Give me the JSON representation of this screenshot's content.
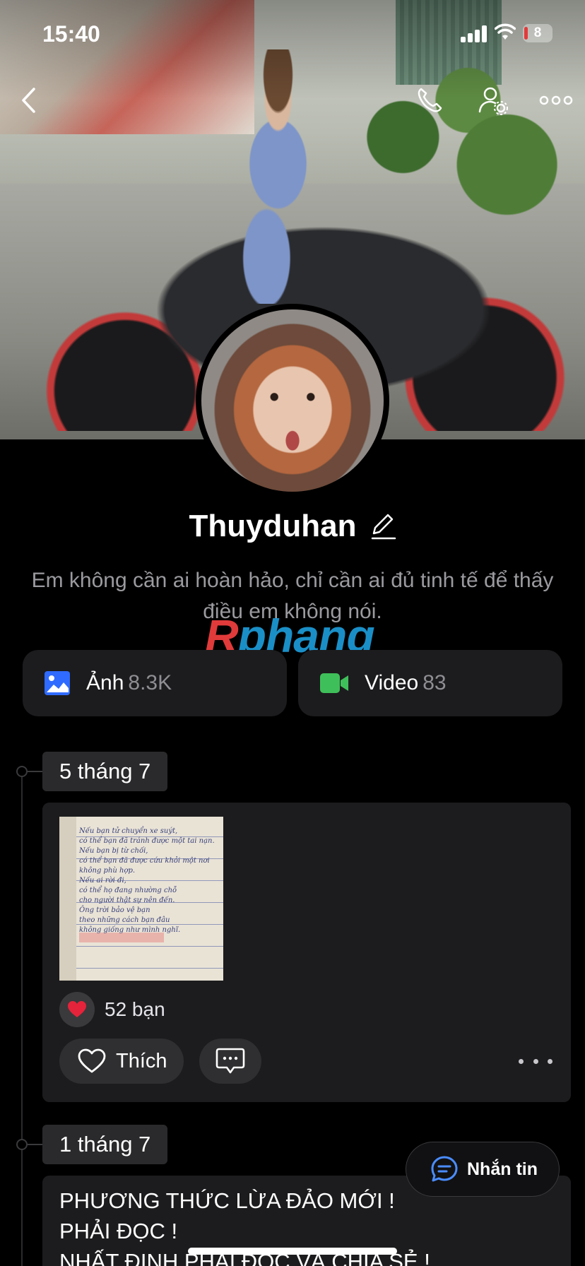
{
  "status_bar": {
    "time": "15:40",
    "battery": "8"
  },
  "profile": {
    "name": "Thuyduhan",
    "bio": "Em không cần ai hoàn hảo, chỉ cần ai đủ tinh tế để thấy điều em không nói."
  },
  "watermark": {
    "part1": "R",
    "part2": "phang"
  },
  "media": {
    "photos": {
      "label": "Ảnh",
      "count": "8.3K"
    },
    "videos": {
      "label": "Video",
      "count": "83"
    }
  },
  "timeline": [
    {
      "date": "5 tháng 7",
      "reaction_count": "52 bạn",
      "like_label": "Thích",
      "note_lines": [
        "Nếu bạn tử chuyển xe suýt,",
        "có thể bạn đã tránh được một tai nạn.",
        "Nếu bạn bị từ chối,",
        "có thể bạn đã được cứu khỏi một nơi không phù hợp.",
        "Nếu ai rời đi,",
        "có thể họ đang nhường chỗ",
        "cho người thật sự nên đến.",
        "Ông trời bảo vệ bạn",
        "theo những cách bạn đâu",
        "không giống như mình nghĩ."
      ]
    },
    {
      "date": "1 tháng 7",
      "text_lines": [
        "PHƯƠNG THỨC LỪA ĐẢO MỚI !",
        "PHẢI ĐỌC !",
        "NHẤT ĐỊNH PHẢI ĐỌC VÀ CHIA SẺ !"
      ]
    }
  ],
  "message_button": {
    "label": "Nhắn tin"
  },
  "colors": {
    "photo_icon": "#2f6bff",
    "video_icon": "#3fbf5a",
    "chat_icon": "#4a8cff",
    "heart": "#e5233a"
  }
}
